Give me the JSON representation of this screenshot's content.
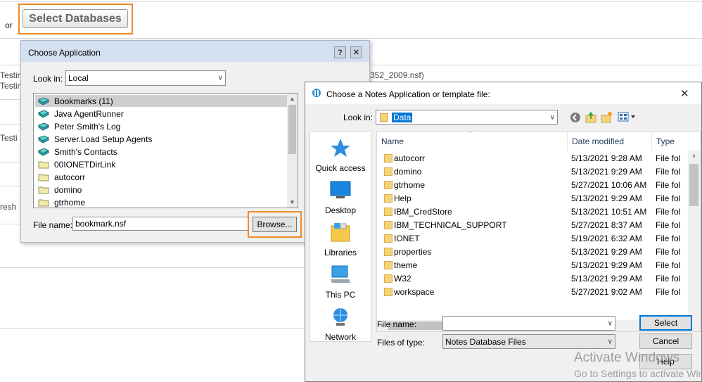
{
  "background": {
    "or_label": "or",
    "select_button": "Select Databases",
    "row_texts": [
      "Testin",
      "Testin",
      "Testi",
      "resh"
    ],
    "path_fragment": "352_2009.nsf)"
  },
  "choose_app": {
    "title": "Choose Application",
    "help_glyph": "?",
    "close_glyph": "✕",
    "look_in_label": "Look in:",
    "look_in_value": "Local",
    "items": [
      {
        "label": "Bookmarks (11)",
        "icon": "database-icon",
        "selected": true
      },
      {
        "label": "Java AgentRunner",
        "icon": "database-icon",
        "selected": false
      },
      {
        "label": "Peter Smith's Log",
        "icon": "database-icon",
        "selected": false
      },
      {
        "label": "Server.Load Setup Agents",
        "icon": "database-icon",
        "selected": false
      },
      {
        "label": "Smith's Contacts",
        "icon": "database-icon",
        "selected": false
      },
      {
        "label": "00IONETDirLink",
        "icon": "folder-icon",
        "selected": false
      },
      {
        "label": "autocorr",
        "icon": "folder-icon",
        "selected": false
      },
      {
        "label": "domino",
        "icon": "folder-icon",
        "selected": false
      },
      {
        "label": "gtrhome",
        "icon": "folder-icon",
        "selected": false
      }
    ],
    "file_name_label": "File name:",
    "file_name_value": "bookmark.nsf",
    "browse_label": "Browse..."
  },
  "notes_dialog": {
    "title": "Choose a Notes Application or template file:",
    "close_glyph": "✕",
    "look_in_label": "Look in:",
    "look_in_value": "Data",
    "places": [
      "Quick access",
      "Desktop",
      "Libraries",
      "This PC",
      "Network"
    ],
    "columns": [
      "Name",
      "Date modified",
      "Type"
    ],
    "files": [
      {
        "name": "autocorr",
        "date": "5/13/2021 9:28 AM",
        "type": "File fol"
      },
      {
        "name": "domino",
        "date": "5/13/2021 9:29 AM",
        "type": "File fol"
      },
      {
        "name": "gtrhome",
        "date": "5/27/2021 10:06 AM",
        "type": "File fol"
      },
      {
        "name": "Help",
        "date": "5/13/2021 9:29 AM",
        "type": "File fol"
      },
      {
        "name": "IBM_CredStore",
        "date": "5/13/2021 10:51 AM",
        "type": "File fol"
      },
      {
        "name": "IBM_TECHNICAL_SUPPORT",
        "date": "5/27/2021 8:37 AM",
        "type": "File fol"
      },
      {
        "name": "IONET",
        "date": "5/19/2021 6:32 AM",
        "type": "File fol"
      },
      {
        "name": "properties",
        "date": "5/13/2021 9:29 AM",
        "type": "File fol"
      },
      {
        "name": "theme",
        "date": "5/13/2021 9:29 AM",
        "type": "File fol"
      },
      {
        "name": "W32",
        "date": "5/13/2021 9:29 AM",
        "type": "File fol"
      },
      {
        "name": "workspace",
        "date": "5/27/2021 9:02 AM",
        "type": "File fol"
      }
    ],
    "file_name_label": "File name:",
    "file_name_value": "",
    "files_of_type_label": "Files of type:",
    "files_of_type_value": "Notes Database Files",
    "select_label": "Select",
    "cancel_label": "Cancel",
    "help_label": "Help"
  },
  "watermark": {
    "line1": "Activate Windows",
    "line2": "Go to Settings to activate Windows."
  },
  "colors": {
    "highlight_orange": "#f08a24",
    "dialog_title_blue": "#d4e0ef",
    "select_focus_blue": "#0078d7"
  }
}
